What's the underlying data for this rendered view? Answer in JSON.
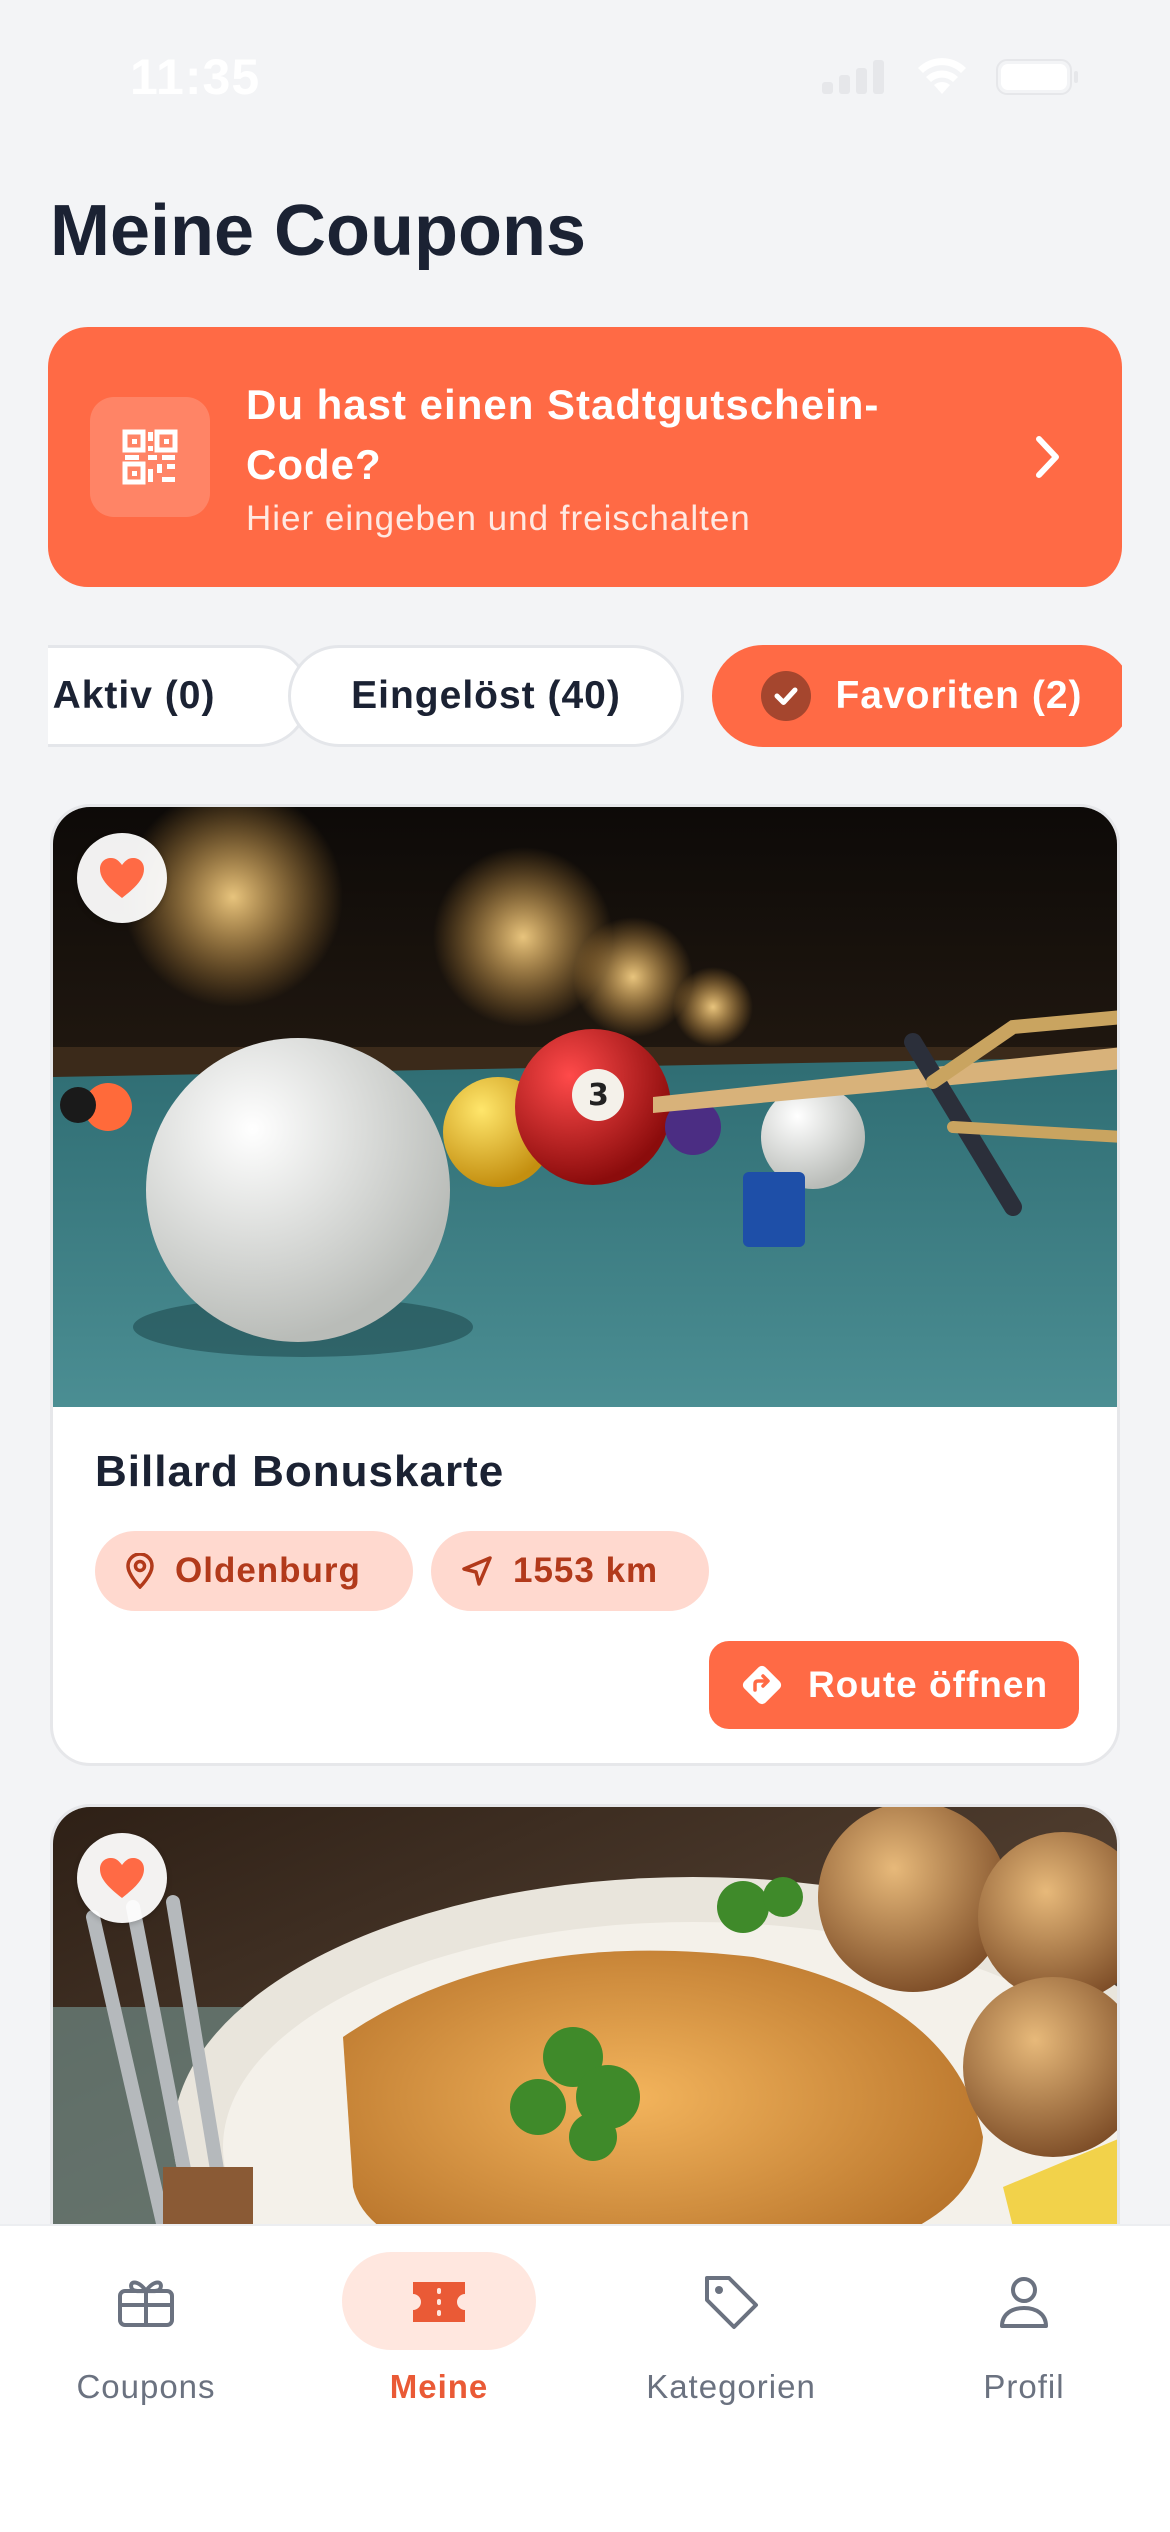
{
  "status_bar": {
    "time": "11:35"
  },
  "page": {
    "title": "Meine Coupons"
  },
  "promo": {
    "title": "Du hast einen Stadtgutschein-Code?",
    "subtitle": "Hier eingeben und freischalten",
    "icon": "qr-code-icon"
  },
  "filters": [
    {
      "label": "Aktiv (0)",
      "active": false
    },
    {
      "label": "Eingelöst (40)",
      "active": false
    },
    {
      "label": "Favoriten (2)",
      "active": true,
      "icon": "check-circle-icon"
    }
  ],
  "coupons": [
    {
      "title": "Billard Bonuskarte",
      "favorite": true,
      "image": "billiard-table-photo",
      "city": "Oldenburg",
      "distance": "1553 km",
      "route_label": "Route öffnen"
    },
    {
      "title": "",
      "favorite": true,
      "image": "schnitzel-plate-photo"
    }
  ],
  "tabbar": [
    {
      "label": "Coupons",
      "icon": "gift-card-icon",
      "active": false
    },
    {
      "label": "Meine",
      "icon": "ticket-icon",
      "active": true
    },
    {
      "label": "Kategorien",
      "icon": "tag-icon",
      "active": false
    },
    {
      "label": "Profil",
      "icon": "user-icon",
      "active": false
    }
  ],
  "colors": {
    "accent": "#ff6a45",
    "background": "#f3f4f6",
    "text": "#1b2233",
    "tag_bg": "#ffd9cf",
    "tag_text": "#b23a1b"
  }
}
